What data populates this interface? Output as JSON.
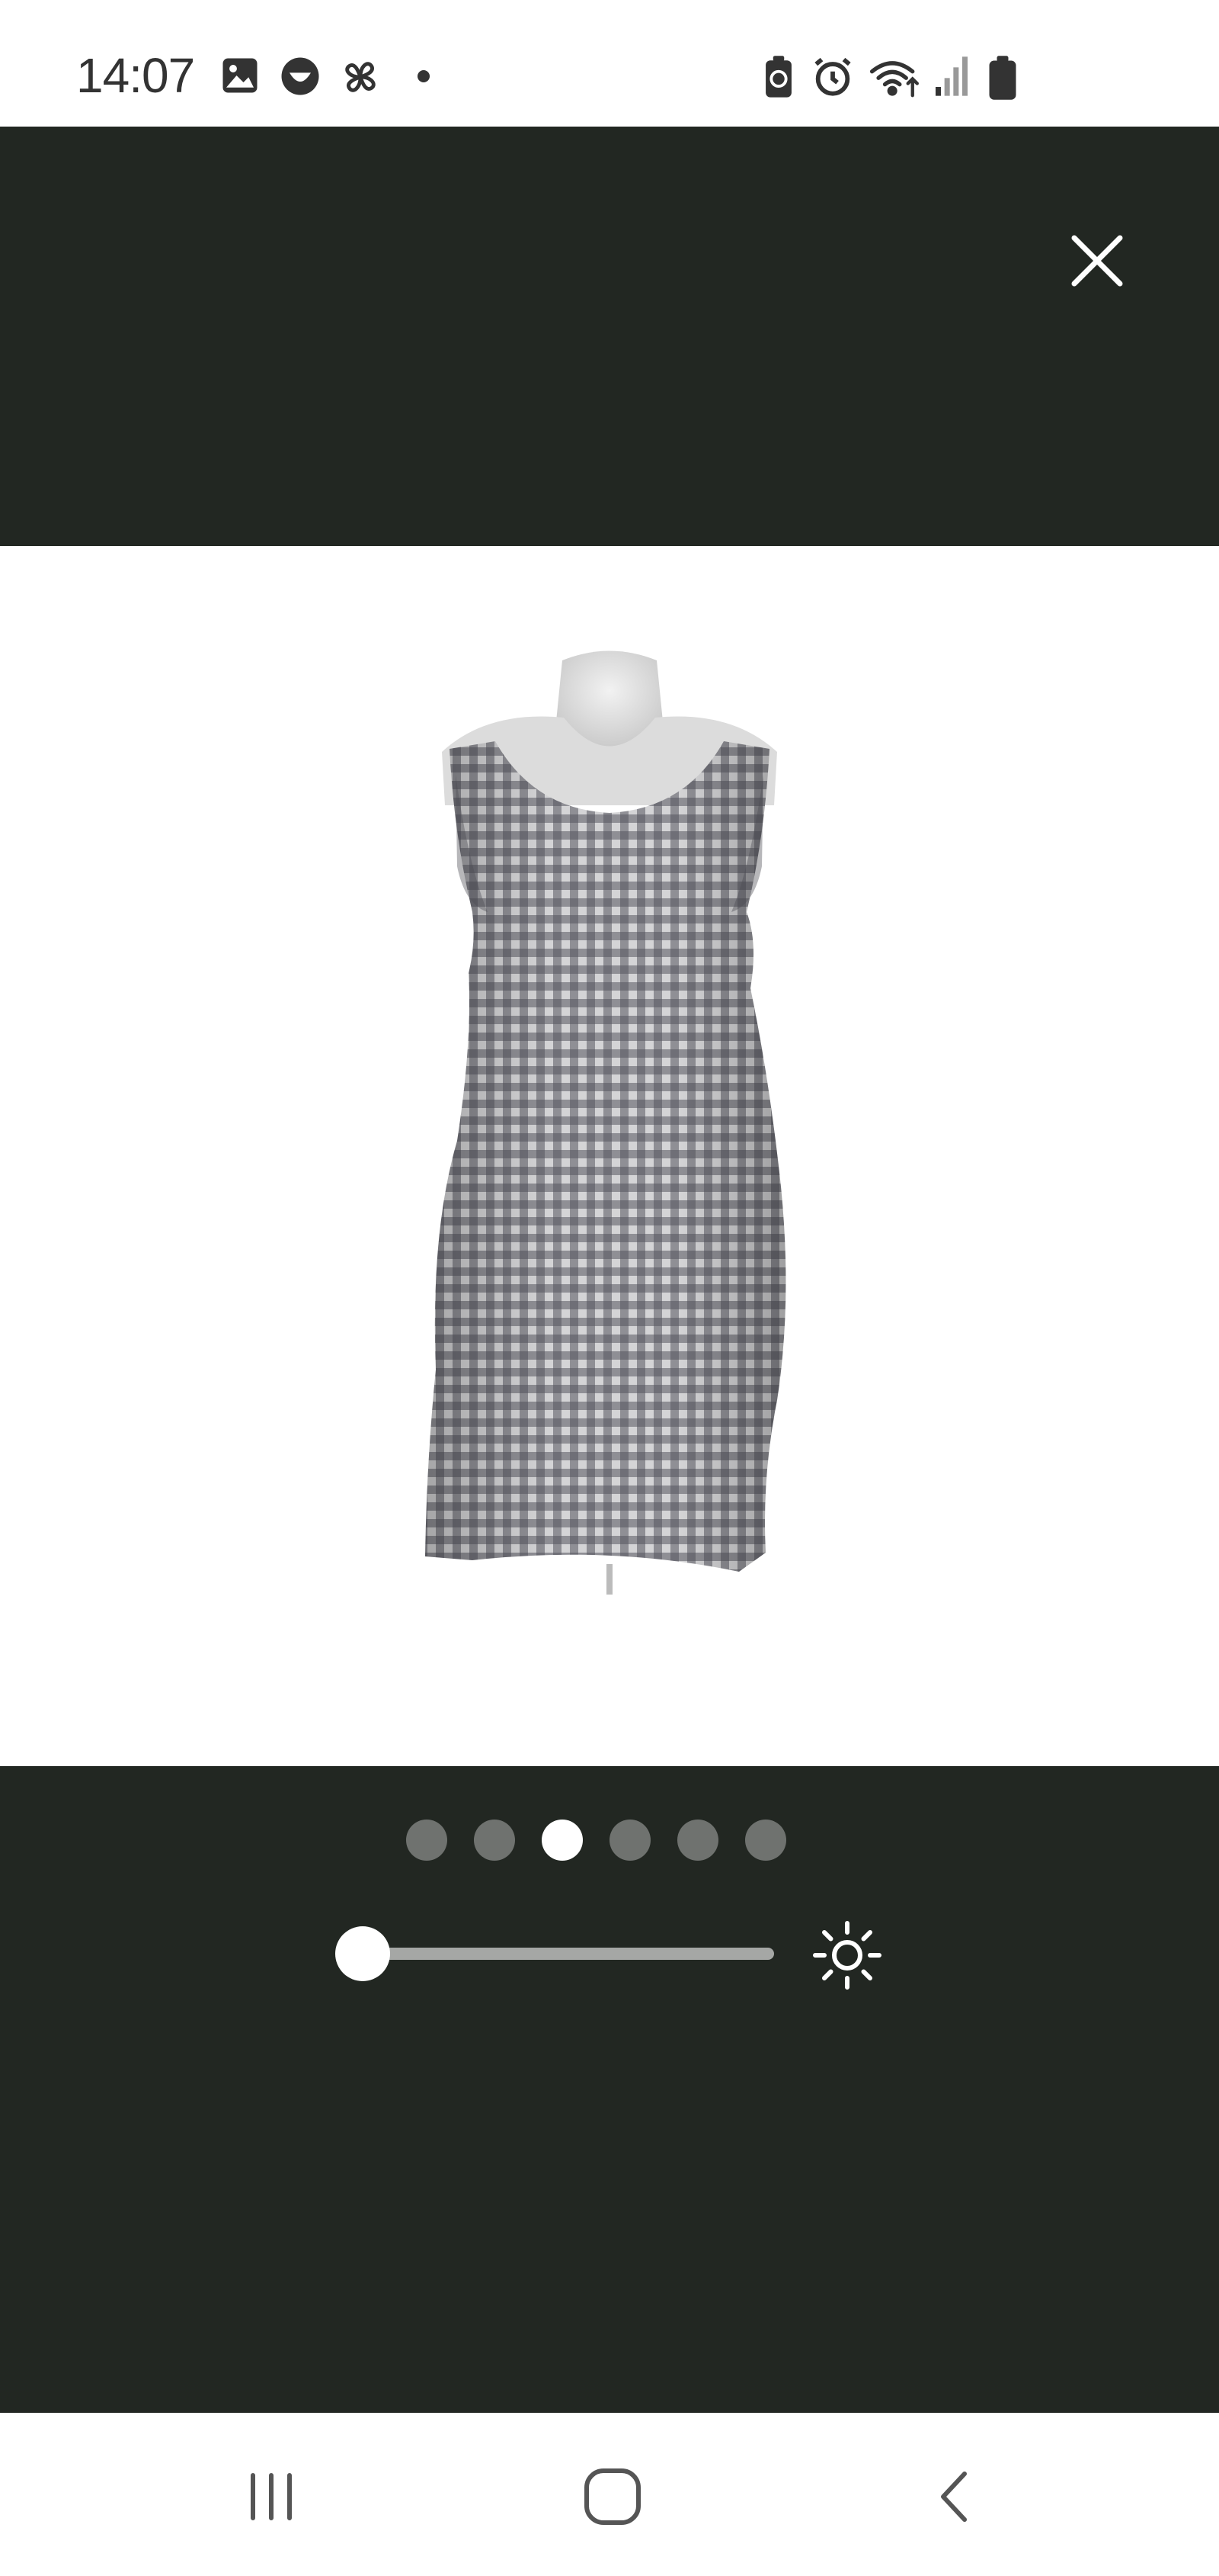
{
  "status_bar": {
    "time": "14:07",
    "left_icons": [
      "gallery-icon",
      "face-icon",
      "pinwheel-icon",
      "dot-icon"
    ],
    "right_icons": [
      "battery-saver-icon",
      "alarm-icon",
      "wifi-icon",
      "signal-icon",
      "battery-icon"
    ]
  },
  "viewer": {
    "close_icon": "close-icon",
    "image_description_icon": "dress-photo",
    "pagination": {
      "count": 6,
      "active_index": 2
    },
    "brightness": {
      "value": 0,
      "icon": "brightness-icon"
    }
  },
  "nav_bar": {
    "buttons": [
      "recent-apps-icon",
      "home-icon",
      "back-icon"
    ]
  },
  "colors": {
    "viewer_bg": "#222722",
    "dot_inactive": "#6f726f",
    "dot_active": "#ffffff",
    "track": "#a5a7a5"
  }
}
